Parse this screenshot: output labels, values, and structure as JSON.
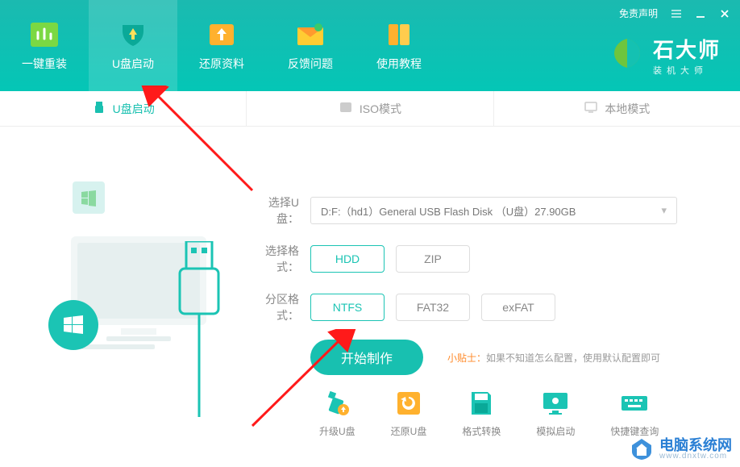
{
  "titlebar": {
    "disclaimer": "免责声明"
  },
  "brand": {
    "title": "石大师",
    "subtitle": "装机大师"
  },
  "nav": [
    {
      "label": "一键重装"
    },
    {
      "label": "U盘启动"
    },
    {
      "label": "还原资料"
    },
    {
      "label": "反馈问题"
    },
    {
      "label": "使用教程"
    }
  ],
  "modes": [
    {
      "label": "U盘启动"
    },
    {
      "label": "ISO模式"
    },
    {
      "label": "本地模式"
    }
  ],
  "form": {
    "disk_label": "选择U盘：",
    "disk_value": "D:F:（hd1）General USB Flash Disk （U盘）27.90GB",
    "format_label": "选择格式：",
    "format_options": [
      "HDD",
      "ZIP"
    ],
    "format_selected": 0,
    "partition_label": "分区格式：",
    "partition_options": [
      "NTFS",
      "FAT32",
      "exFAT"
    ],
    "partition_selected": 0,
    "start_label": "开始制作",
    "tip_label": "小贴士：",
    "tip_text": "如果不知道怎么配置，使用默认配置即可"
  },
  "tools": [
    {
      "label": "升级U盘"
    },
    {
      "label": "还原U盘"
    },
    {
      "label": "格式转换"
    },
    {
      "label": "模拟启动"
    },
    {
      "label": "快捷键查询"
    }
  ],
  "watermark": {
    "title": "电脑系统网",
    "url": "www.dnxtw.com"
  }
}
